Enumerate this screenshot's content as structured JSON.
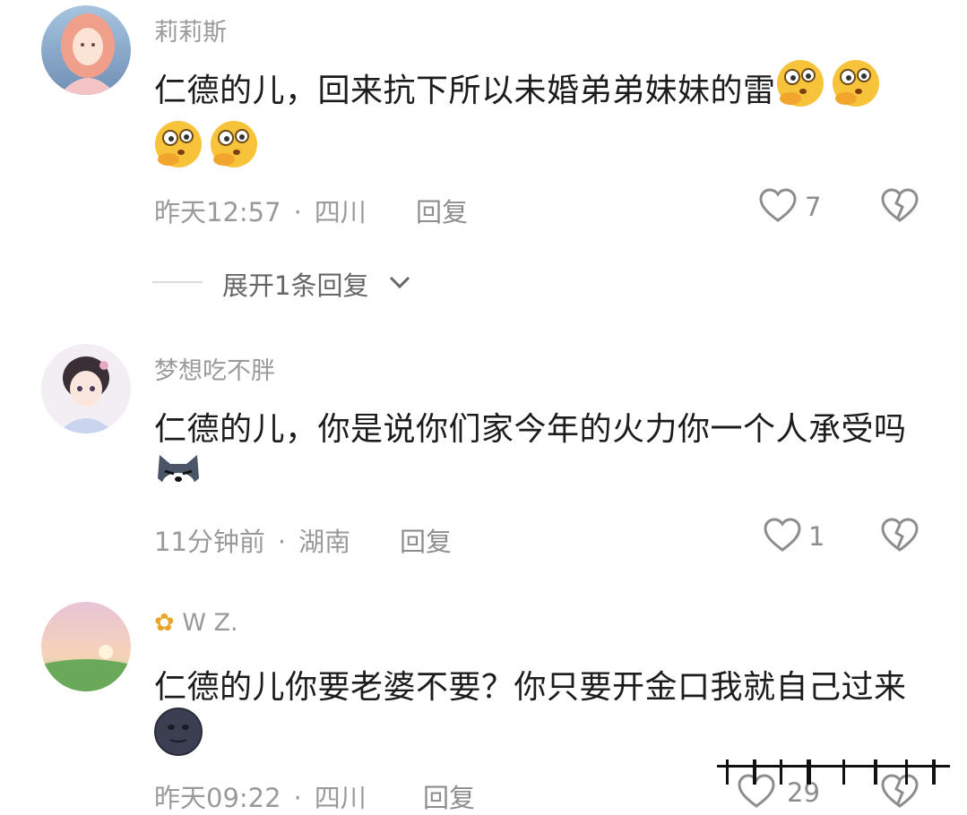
{
  "comments": [
    {
      "username": "莉莉斯",
      "text_line1": "仁德的儿，回来抗下所以未婚弟弟妹妹的雷",
      "time": "昨天12:57",
      "location": "四川",
      "reply_label": "回复",
      "likes": "7",
      "emojis": [
        "thinking-emoji",
        "thinking-emoji",
        "thinking-emoji",
        "thinking-emoji"
      ]
    },
    {
      "username": "梦想吃不胖",
      "text_line1": "仁德的儿，你是说你们家今年的火力你一个人承受吗",
      "time": "11分钟前",
      "location": "湖南",
      "reply_label": "回复",
      "likes": "1",
      "emojis": [
        "wolf-emoji"
      ]
    },
    {
      "username": "W Z.",
      "text_line1": "仁德的儿你要老婆不要？你只要开金口我就自己过来",
      "time": "昨天09:22",
      "location": "四川",
      "reply_label": "回复",
      "likes": "29",
      "emojis": [
        "dark-face-emoji"
      ]
    }
  ],
  "expand_replies": "展开1条回复",
  "separator": "·",
  "colors": {
    "meta": "#9a9a9a",
    "text": "#1c1c1c",
    "emoji_yellow": "#f7c33a"
  }
}
